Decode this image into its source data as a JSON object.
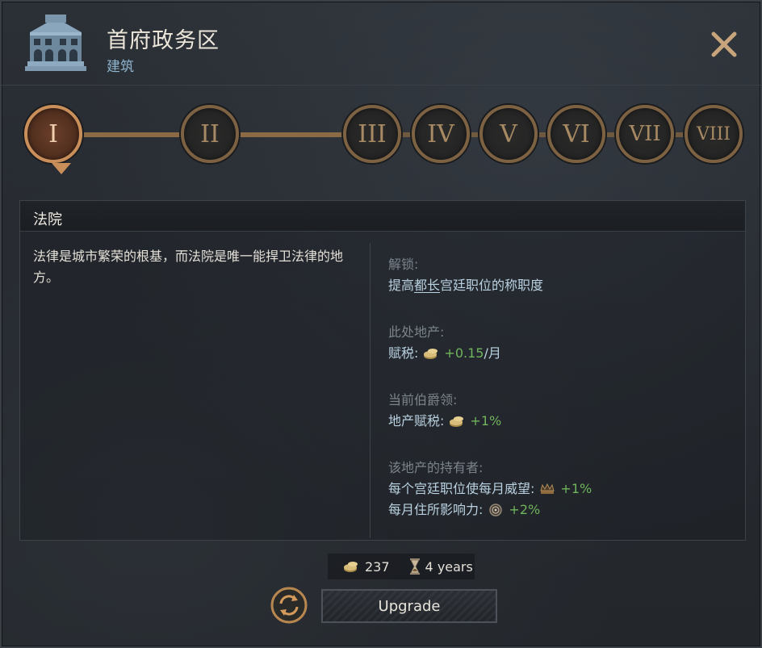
{
  "header": {
    "title": "首府政务区",
    "subtitle": "建筑"
  },
  "levels": [
    "I",
    "II",
    "III",
    "IV",
    "V",
    "VI",
    "VII",
    "VIII"
  ],
  "active_level_index": 0,
  "content": {
    "title": "法院",
    "description": "法律是城市繁荣的根基，而法院是唯一能捍卫法律的地方。",
    "unlock": {
      "heading": "解锁:",
      "prefix": "提高",
      "link": "都长",
      "suffix": "宫廷职位的称职度"
    },
    "holding": {
      "heading": "此处地产:",
      "label": "赋税:",
      "value": "+0.15",
      "unit": "/月"
    },
    "county": {
      "heading": "当前伯爵领:",
      "label": "地产赋税:",
      "value": "+1%"
    },
    "holder": {
      "heading": "该地产的持有者:",
      "line1_label": "每个宫廷职位使每月威望:",
      "line1_value": "+1%",
      "line2_label": "每月住所影响力:",
      "line2_value": "+2%"
    }
  },
  "cost": {
    "gold": "237",
    "time": "4 years"
  },
  "upgrade_label": "Upgrade",
  "icons": {
    "building": "building-icon",
    "close": "close-icon",
    "gold": "gold-coins-icon",
    "prestige": "crown-icon",
    "influence": "influence-icon",
    "time": "hourglass-icon",
    "refresh": "refresh-icon"
  },
  "colors": {
    "positive": "#6fb35c",
    "accent_bronze": "#c98f5a",
    "subtitle_blue": "#8fb5cf"
  }
}
